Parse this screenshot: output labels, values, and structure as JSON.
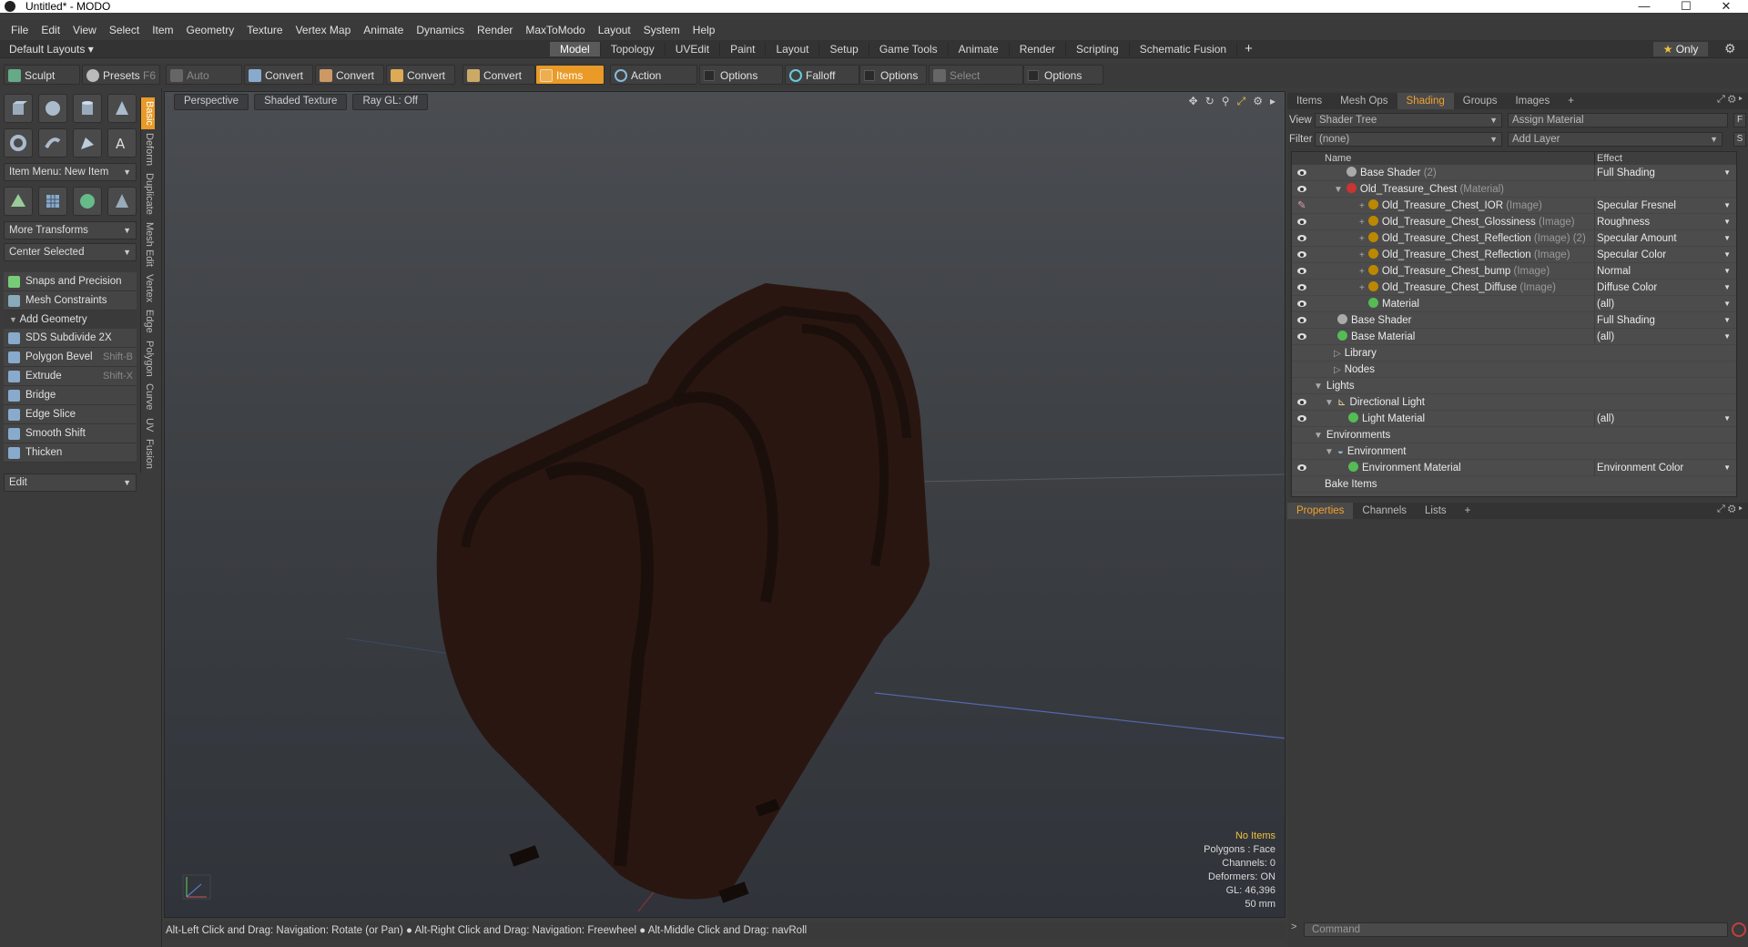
{
  "window": {
    "title": "Untitled* - MODO",
    "minimize": "—",
    "maximize": "☐",
    "close": "✕"
  },
  "menu": [
    "File",
    "Edit",
    "View",
    "Select",
    "Item",
    "Geometry",
    "Texture",
    "Vertex Map",
    "Animate",
    "Dynamics",
    "Render",
    "MaxToModo",
    "Layout",
    "System",
    "Help"
  ],
  "layout_bar": {
    "layout_selector": "Default Layouts ▾",
    "tabs": [
      "Model",
      "Topology",
      "UVEdit",
      "Paint",
      "Layout",
      "Setup",
      "Game Tools",
      "Animate",
      "Render",
      "Scripting",
      "Schematic Fusion"
    ],
    "active_tab": "Model",
    "plus": "+",
    "only_label": "Only"
  },
  "toolbar": {
    "sculpt": "Sculpt",
    "presets": "Presets",
    "presets_key": "F6",
    "auto_select": "Auto Select",
    "convert1": "Convert",
    "convert2": "Convert",
    "convert3": "Convert",
    "convert4": "Convert",
    "items": "Items",
    "action_center": "Action Center",
    "options1": "Options",
    "falloff": "Falloff",
    "options2": "Options",
    "select_through": "Select Through",
    "options3": "Options"
  },
  "left_panel": {
    "item_menu": "Item Menu: New Item",
    "more_transforms": "More Transforms",
    "center_selected": "Center Selected",
    "snaps": "Snaps and Precision",
    "mesh_constraints": "Mesh Constraints",
    "add_geometry": "Add Geometry",
    "tools": [
      {
        "label": "SDS Subdivide 2X",
        "shortcut": ""
      },
      {
        "label": "Polygon Bevel",
        "shortcut": "Shift-B"
      },
      {
        "label": "Extrude",
        "shortcut": "Shift-X"
      },
      {
        "label": "Bridge",
        "shortcut": ""
      },
      {
        "label": "Edge Slice",
        "shortcut": ""
      },
      {
        "label": "Smooth Shift",
        "shortcut": ""
      },
      {
        "label": "Thicken",
        "shortcut": ""
      }
    ],
    "edit_dropdown": "Edit",
    "vertical_tabs": [
      "Basic",
      "Deform",
      "Duplicate",
      "Mesh Edit",
      "Vertex",
      "Edge",
      "Polygon",
      "Curve",
      "UV",
      "Fusion"
    ]
  },
  "viewport": {
    "view_mode": "Perspective",
    "shading": "Shaded Texture",
    "raygl": "Ray GL: Off",
    "info": {
      "no_items": "No Items",
      "polygons": "Polygons : Face",
      "channels": "Channels: 0",
      "deformers": "Deformers: ON",
      "gl": "GL: 46,396",
      "scale": "50 mm"
    }
  },
  "status_bar": "Alt-Left Click and Drag: Navigation: Rotate (or Pan) ● Alt-Right Click and Drag: Navigation: Freewheel ● Alt-Middle Click and Drag: navRoll",
  "right_panel": {
    "top_tabs": [
      "Items",
      "Mesh Ops",
      "Shading",
      "Groups",
      "Images"
    ],
    "active_top_tab": "Shading",
    "view_label": "View",
    "view_value": "Shader Tree",
    "assign_material": "Assign Material",
    "f_btn": "F",
    "filter_label": "Filter",
    "filter_value": "(none)",
    "add_layer": "Add Layer",
    "s_btn": "S",
    "col_name": "Name",
    "col_effect": "Effect",
    "rows": [
      {
        "name": "Base Shader",
        "tag": "(2)",
        "effect": "Full Shading"
      },
      {
        "name": "Old_Treasure_Chest",
        "tag": "(Material)",
        "effect": ""
      },
      {
        "name": "Old_Treasure_Chest_IOR",
        "tag": "(Image)",
        "effect": "Specular Fresnel"
      },
      {
        "name": "Old_Treasure_Chest_Glossiness",
        "tag": "(Image)",
        "effect": "Roughness"
      },
      {
        "name": "Old_Treasure_Chest_Reflection",
        "tag": "(Image) (2)",
        "effect": "Specular Amount"
      },
      {
        "name": "Old_Treasure_Chest_Reflection",
        "tag": "(Image)",
        "effect": "Specular Color"
      },
      {
        "name": "Old_Treasure_Chest_bump",
        "tag": "(Image)",
        "effect": "Normal"
      },
      {
        "name": "Old_Treasure_Chest_Diffuse",
        "tag": "(Image)",
        "effect": "Diffuse Color"
      },
      {
        "name": "Material",
        "tag": "",
        "effect": "(all)"
      },
      {
        "name": "Base Shader",
        "tag": "",
        "effect": "Full Shading"
      },
      {
        "name": "Base Material",
        "tag": "",
        "effect": "(all)"
      },
      {
        "name": "Library",
        "tag": "",
        "effect": ""
      },
      {
        "name": "Nodes",
        "tag": "",
        "effect": ""
      },
      {
        "name": "Lights",
        "tag": "",
        "effect": ""
      },
      {
        "name": "Directional Light",
        "tag": "",
        "effect": ""
      },
      {
        "name": "Light Material",
        "tag": "",
        "effect": "(all)"
      },
      {
        "name": "Environments",
        "tag": "",
        "effect": ""
      },
      {
        "name": "Environment",
        "tag": "",
        "effect": ""
      },
      {
        "name": "Environment Material",
        "tag": "",
        "effect": "Environment Color"
      },
      {
        "name": "Bake Items",
        "tag": "",
        "effect": ""
      }
    ],
    "bottom_tabs": [
      "Properties",
      "Channels",
      "Lists"
    ],
    "active_bottom_tab": "Properties",
    "plus": "+",
    "command_placeholder": "Command"
  },
  "colors": {
    "accent": "#e99a27",
    "panel": "#3a3a3a",
    "tree_bg": "#4c4c4c"
  }
}
